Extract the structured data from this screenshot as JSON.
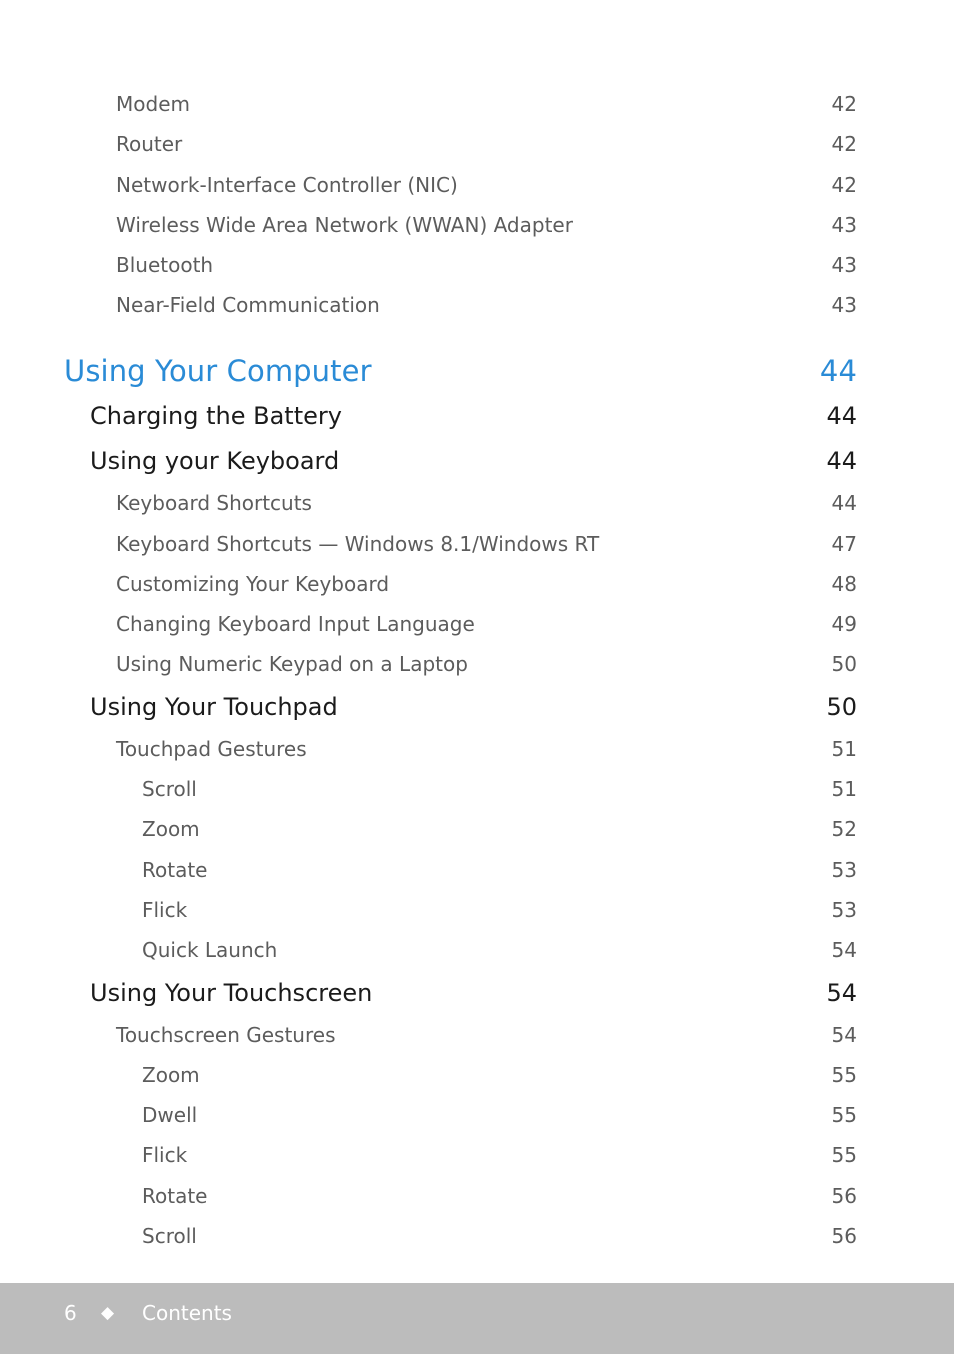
{
  "toc": {
    "entries": [
      {
        "level": "sub",
        "label": "Modem",
        "page": "42"
      },
      {
        "level": "sub",
        "label": "Router",
        "page": "42"
      },
      {
        "level": "sub",
        "label": "Network-Interface Controller (NIC)",
        "page": "42"
      },
      {
        "level": "sub",
        "label": "Wireless Wide Area Network (WWAN) Adapter",
        "page": "43"
      },
      {
        "level": "sub",
        "label": "Bluetooth",
        "page": "43"
      },
      {
        "level": "sub",
        "label": "Near-Field Communication",
        "page": "43"
      },
      {
        "level": "chapter",
        "label": "Using Your Computer",
        "page": "44"
      },
      {
        "level": "section",
        "label": "Charging the Battery",
        "page": "44"
      },
      {
        "level": "section",
        "label": "Using your Keyboard",
        "page": "44"
      },
      {
        "level": "sub",
        "label": "Keyboard Shortcuts",
        "page": "44"
      },
      {
        "level": "sub",
        "label": "Keyboard Shortcuts — Windows 8.1/Windows RT",
        "page": "47"
      },
      {
        "level": "sub",
        "label": "Customizing Your Keyboard",
        "page": "48"
      },
      {
        "level": "sub",
        "label": "Changing Keyboard Input Language",
        "page": "49"
      },
      {
        "level": "sub",
        "label": "Using Numeric Keypad on a Laptop",
        "page": "50"
      },
      {
        "level": "section",
        "label": "Using Your Touchpad",
        "page": "50"
      },
      {
        "level": "sub",
        "label": "Touchpad Gestures",
        "page": "51"
      },
      {
        "level": "subsub",
        "label": "Scroll",
        "page": "51"
      },
      {
        "level": "subsub",
        "label": "Zoom",
        "page": "52"
      },
      {
        "level": "subsub",
        "label": "Rotate",
        "page": "53"
      },
      {
        "level": "subsub",
        "label": "Flick",
        "page": "53"
      },
      {
        "level": "subsub",
        "label": "Quick Launch",
        "page": "54"
      },
      {
        "level": "section",
        "label": "Using Your Touchscreen",
        "page": "54"
      },
      {
        "level": "sub",
        "label": "Touchscreen Gestures",
        "page": "54"
      },
      {
        "level": "subsub",
        "label": "Zoom",
        "page": "55"
      },
      {
        "level": "subsub",
        "label": "Dwell",
        "page": "55"
      },
      {
        "level": "subsub",
        "label": "Flick",
        "page": "55"
      },
      {
        "level": "subsub",
        "label": "Rotate",
        "page": "56"
      },
      {
        "level": "subsub",
        "label": "Scroll",
        "page": "56"
      }
    ]
  },
  "footer": {
    "page_number": "6",
    "separator_icon": "diamond-icon",
    "separator_glyph": "◆",
    "section_title": "Contents"
  },
  "colors": {
    "chapter": "#2a8bd6",
    "section": "#1b1b1b",
    "subsection": "#5c5c5c",
    "footer_band": "#bcbcbc",
    "footer_text": "#ffffff"
  }
}
